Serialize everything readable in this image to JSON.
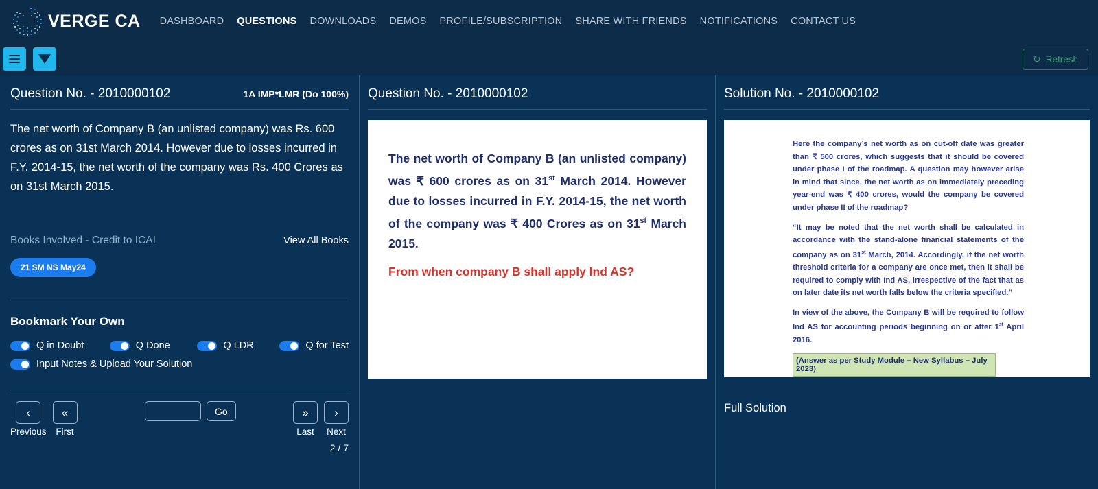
{
  "header": {
    "brand": "VERGE CA",
    "logo_icon": "dot-ring-logo",
    "nav": [
      {
        "label": "DASHBOARD",
        "active": false
      },
      {
        "label": "QUESTIONS",
        "active": true
      },
      {
        "label": "DOWNLOADS",
        "active": false
      },
      {
        "label": "DEMOS",
        "active": false
      },
      {
        "label": "PROFILE/SUBSCRIPTION",
        "active": false
      },
      {
        "label": "SHARE WITH FRIENDS",
        "active": false
      },
      {
        "label": "NOTIFICATIONS",
        "active": false
      },
      {
        "label": "CONTACT US",
        "active": false
      }
    ]
  },
  "toolbar": {
    "menu_icon": "hamburger-menu-icon",
    "filter_icon": "filter-funnel-icon",
    "refresh_label": "Refresh",
    "refresh_icon": "refresh-icon",
    "refresh_glyph": "↻"
  },
  "left_panel": {
    "title": "Question No. - 2010000102",
    "tag": "1A IMP*LMR (Do 100%)",
    "question_text": "The net worth of Company B (an unlisted company) was Rs. 600 crores as on 31st March 2014. However due to losses incurred in F.Y. 2014-15, the net worth of the company was Rs. 400 Crores as on 31st March 2015.",
    "books_label": "Books Involved - Credit to ICAI",
    "view_all_books": "View All Books",
    "badges": [
      "21 SM NS May24"
    ],
    "bookmark_title": "Bookmark Your Own",
    "toggles": [
      {
        "label": "Q in Doubt",
        "on": true
      },
      {
        "label": "Q Done",
        "on": true
      },
      {
        "label": "Q LDR",
        "on": true
      },
      {
        "label": "Q for Test",
        "on": true
      },
      {
        "label": "Input Notes & Upload Your Solution",
        "on": true
      }
    ],
    "pager": {
      "previous_glyph": "‹",
      "previous_label": "Previous",
      "first_glyph": "«",
      "first_label": "First",
      "page_input_value": "",
      "page_input_placeholder": "",
      "go_label": "Go",
      "last_glyph": "»",
      "last_label": "Last",
      "next_glyph": "›",
      "next_label": "Next",
      "page_count": "2 / 7"
    }
  },
  "middle_panel": {
    "title": "Question No. - 2010000102",
    "paragraph_pre": "The net worth of Company B (an unlisted company) was ₹ 600 crores as on 31",
    "paragraph_sup1": "st",
    "paragraph_mid": " March 2014. However due to losses incurred in F.Y. 2014-15, the net worth of the company was ₹ 400 Crores as on 31",
    "paragraph_sup2": "st",
    "paragraph_post": " March 2015.",
    "question_line": "From when company B shall apply Ind AS?"
  },
  "right_panel": {
    "title": "Solution No. - 2010000102",
    "para1": "Here the company’s net worth as on cut-off date was greater than ₹ 500 crores, which suggests that it should be covered under phase I of the roadmap. A question may however arise in mind that since, the net worth as on immediately preceding year-end was ₹ 400 crores, would the company be covered under phase II of the roadmap?",
    "para2_pre": "“It may be noted that the net worth shall be calculated in accordance with the stand-alone financial statements of the company as on 31",
    "para2_sup": "st",
    "para2_post": " March, 2014. Accordingly, if the net worth threshold criteria for a company are once met, then it shall be required to comply with Ind AS, irrespective of the fact that as on later date its net worth falls below the criteria specified.”",
    "para3_pre": "In view of the above, the Company B will be required to follow Ind AS for accounting periods beginning on or after 1",
    "para3_sup": "st",
    "para3_post": " April 2016.",
    "answer_note": "(Answer as per Study Module – New Syllabus – July 2023)",
    "full_solution_label": "Full Solution"
  },
  "colors": {
    "page_bg": "#0a3257",
    "nav_bg": "#0d2c4a",
    "accent_cyan": "#21b7ec",
    "accent_blue": "#1b7ced",
    "refresh_green": "#3f9b72",
    "doc_text_blue": "#1f2f6b",
    "doc_text_red": "#d9342b",
    "highlight_green": "#cfe5b4",
    "divider": "#2f5a80"
  }
}
